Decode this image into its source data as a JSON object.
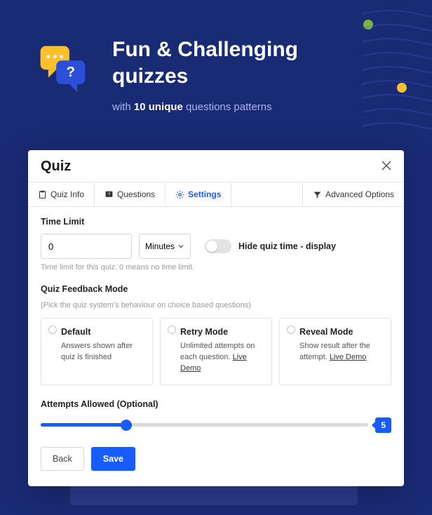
{
  "hero": {
    "title_line1": "Fun & Challenging",
    "title_line2": "quizzes",
    "sub_prefix": "with",
    "sub_bold": "10 unique",
    "sub_suffix": "questions patterns"
  },
  "panel": {
    "title": "Quiz",
    "tabs": {
      "info": "Quiz Info",
      "questions": "Questions",
      "settings": "Settings",
      "advanced": "Advanced Options"
    },
    "timelimit": {
      "label": "Time Limit",
      "value": "0",
      "unit": "Minutes",
      "toggle_label": "Hide quiz time - display",
      "hint": "Time limit for this quiz. 0 means no time limit."
    },
    "feedback": {
      "label": "Quiz Feedback Mode",
      "hint": "(Pick the quiz system's behaviour on choice based questions)",
      "cards": [
        {
          "title": "Default",
          "desc": "Answers shown after quiz is finished",
          "demo": ""
        },
        {
          "title": "Retry Mode",
          "desc": "Unlimited attempts on each question.",
          "demo": "Live Demo"
        },
        {
          "title": "Reveal Mode",
          "desc": "Show result after the attempt.",
          "demo": "Live Demo"
        }
      ]
    },
    "attempts": {
      "label": "Attempts Allowed (Optional)",
      "value": "5"
    },
    "footer": {
      "back": "Back",
      "save": "Save"
    }
  }
}
